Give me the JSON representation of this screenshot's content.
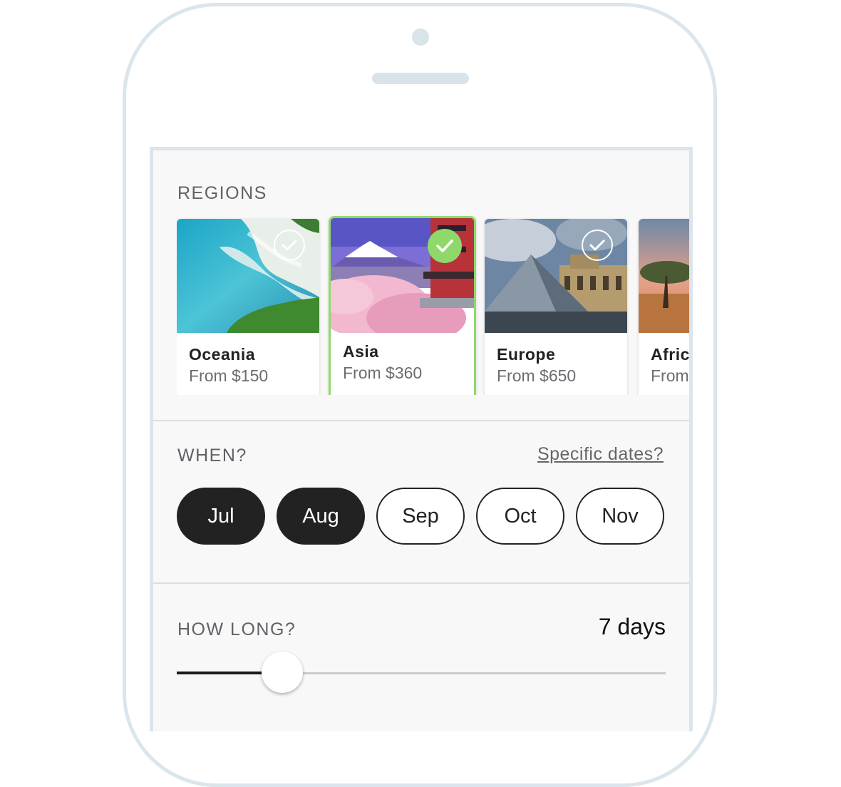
{
  "regions": {
    "title": "REGIONS",
    "items": [
      {
        "name": "Oceania",
        "price": "From $150",
        "selected": false
      },
      {
        "name": "Asia",
        "price": "From $360",
        "selected": true
      },
      {
        "name": "Europe",
        "price": "From $650",
        "selected": false
      },
      {
        "name": "Afric",
        "price": "From",
        "selected": false
      }
    ]
  },
  "when": {
    "title": "WHEN?",
    "specific_link": "Specific dates?",
    "months": [
      {
        "label": "Jul",
        "selected": true
      },
      {
        "label": "Aug",
        "selected": true
      },
      {
        "label": "Sep",
        "selected": false
      },
      {
        "label": "Oct",
        "selected": false
      },
      {
        "label": "Nov",
        "selected": false
      }
    ]
  },
  "how_long": {
    "title": "HOW LONG?",
    "value": "7 days",
    "level": 0.21
  },
  "colors": {
    "accent_selected": "#8fd96b",
    "pill_selected": "#222222",
    "frame": "#dbe5ec"
  }
}
